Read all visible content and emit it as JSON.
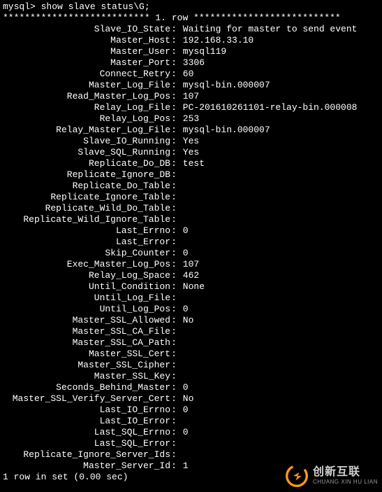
{
  "prompt": "mysql> show slave status\\G;",
  "row_separator": "*************************** 1. row ***************************",
  "fields": [
    {
      "label": "Slave_IO_State",
      "value": "Waiting for master to send event"
    },
    {
      "label": "Master_Host",
      "value": "192.168.33.10"
    },
    {
      "label": "Master_User",
      "value": "mysql119"
    },
    {
      "label": "Master_Port",
      "value": "3306"
    },
    {
      "label": "Connect_Retry",
      "value": "60"
    },
    {
      "label": "Master_Log_File",
      "value": "mysql-bin.000007"
    },
    {
      "label": "Read_Master_Log_Pos",
      "value": "107"
    },
    {
      "label": "Relay_Log_File",
      "value": "PC-201610261101-relay-bin.000008"
    },
    {
      "label": "Relay_Log_Pos",
      "value": "253"
    },
    {
      "label": "Relay_Master_Log_File",
      "value": "mysql-bin.000007"
    },
    {
      "label": "Slave_IO_Running",
      "value": "Yes"
    },
    {
      "label": "Slave_SQL_Running",
      "value": "Yes"
    },
    {
      "label": "Replicate_Do_DB",
      "value": "test"
    },
    {
      "label": "Replicate_Ignore_DB",
      "value": ""
    },
    {
      "label": "Replicate_Do_Table",
      "value": ""
    },
    {
      "label": "Replicate_Ignore_Table",
      "value": ""
    },
    {
      "label": "Replicate_Wild_Do_Table",
      "value": ""
    },
    {
      "label": "Replicate_Wild_Ignore_Table",
      "value": ""
    },
    {
      "label": "Last_Errno",
      "value": "0"
    },
    {
      "label": "Last_Error",
      "value": ""
    },
    {
      "label": "Skip_Counter",
      "value": "0"
    },
    {
      "label": "Exec_Master_Log_Pos",
      "value": "107"
    },
    {
      "label": "Relay_Log_Space",
      "value": "462"
    },
    {
      "label": "Until_Condition",
      "value": "None"
    },
    {
      "label": "Until_Log_File",
      "value": ""
    },
    {
      "label": "Until_Log_Pos",
      "value": "0"
    },
    {
      "label": "Master_SSL_Allowed",
      "value": "No"
    },
    {
      "label": "Master_SSL_CA_File",
      "value": ""
    },
    {
      "label": "Master_SSL_CA_Path",
      "value": ""
    },
    {
      "label": "Master_SSL_Cert",
      "value": ""
    },
    {
      "label": "Master_SSL_Cipher",
      "value": ""
    },
    {
      "label": "Master_SSL_Key",
      "value": ""
    },
    {
      "label": "Seconds_Behind_Master",
      "value": "0"
    },
    {
      "label": "Master_SSL_Verify_Server_Cert",
      "value": "No"
    },
    {
      "label": "Last_IO_Errno",
      "value": "0"
    },
    {
      "label": "Last_IO_Error",
      "value": ""
    },
    {
      "label": "Last_SQL_Errno",
      "value": "0"
    },
    {
      "label": "Last_SQL_Error",
      "value": ""
    },
    {
      "label": "Replicate_Ignore_Server_Ids",
      "value": ""
    },
    {
      "label": "Master_Server_Id",
      "value": "1"
    }
  ],
  "footer": "1 row in set (0.00 sec)",
  "watermark": {
    "cn": "创新互联",
    "en": "CHUANG XIN HU LIAN",
    "icon_color": "#f7991c"
  }
}
